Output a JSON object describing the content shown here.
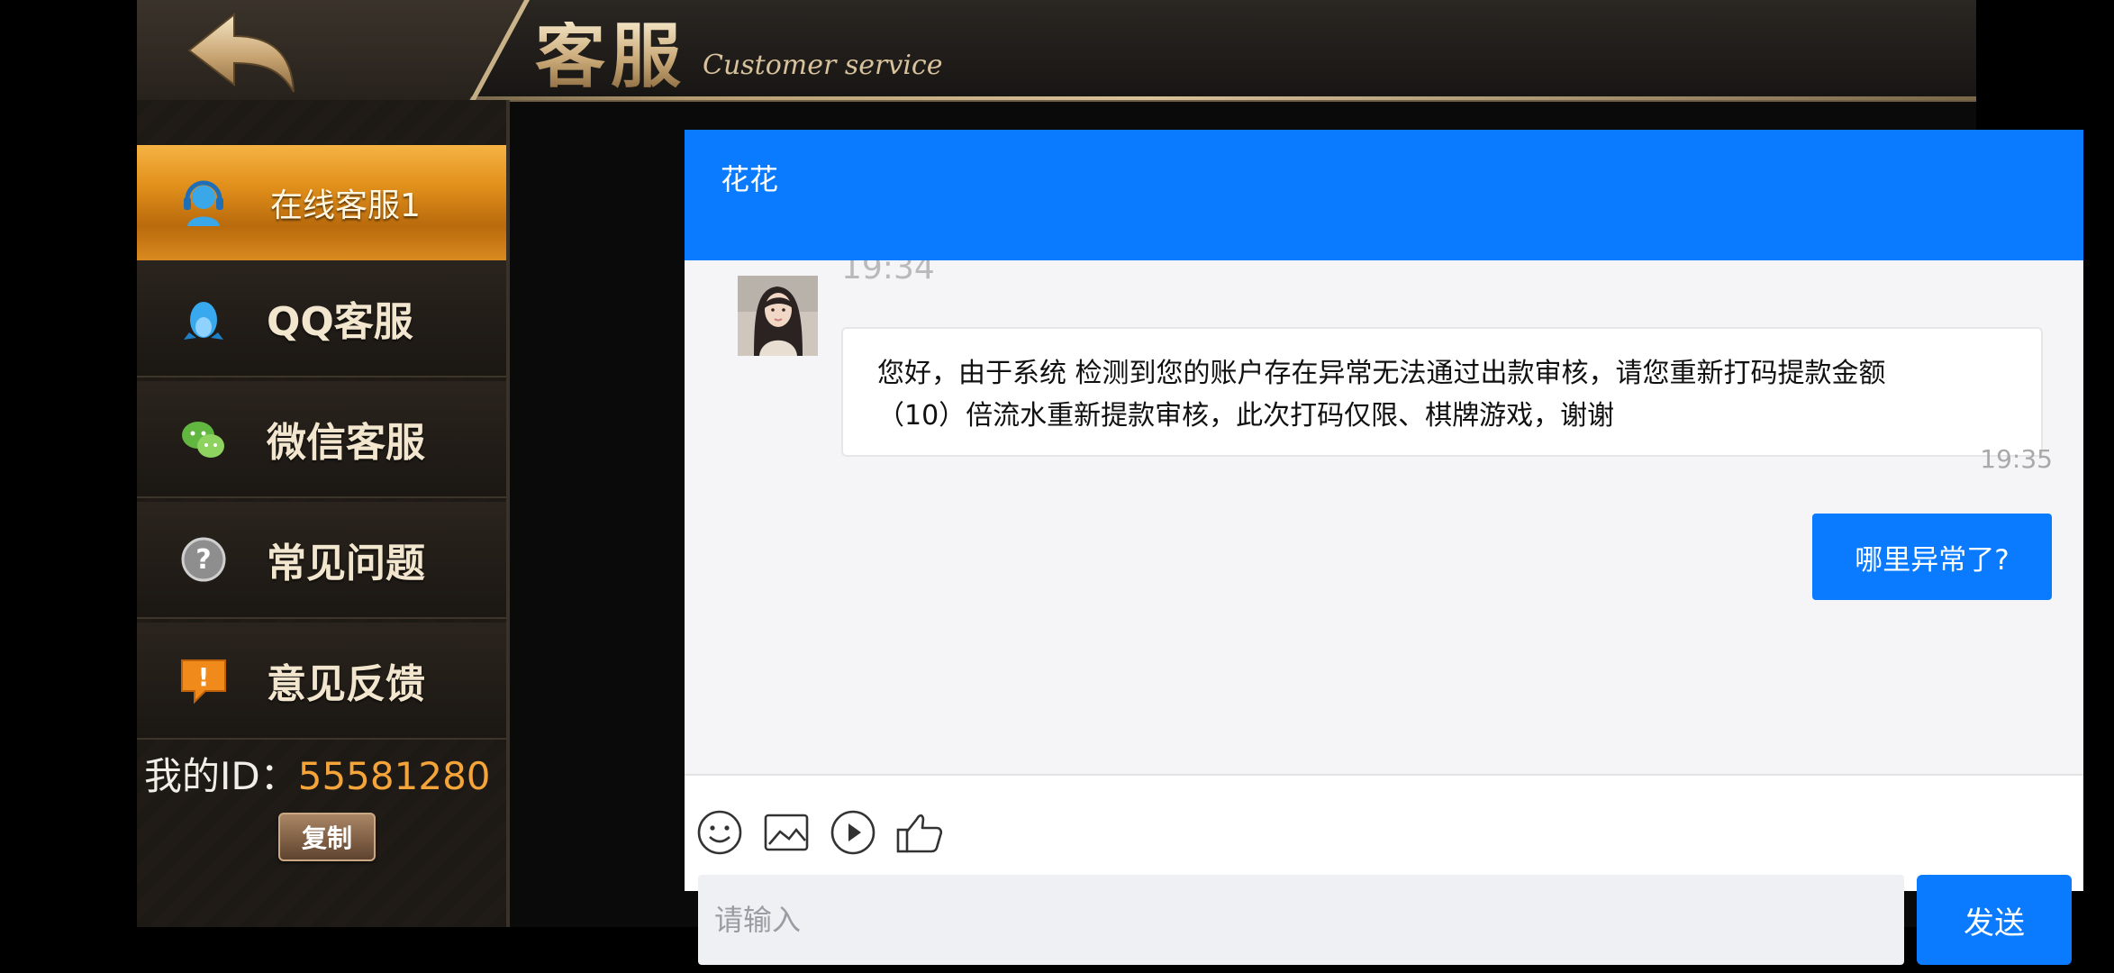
{
  "header": {
    "title_cn": "客服",
    "title_en": "Customer service"
  },
  "sidebar": {
    "items": [
      {
        "label": "在线客服1",
        "icon": "headset-icon",
        "active": true
      },
      {
        "label": "QQ客服",
        "icon": "qq-penguin-icon"
      },
      {
        "label": "微信客服",
        "icon": "wechat-icon"
      },
      {
        "label": "常见问题",
        "icon": "question-icon"
      },
      {
        "label": "意见反馈",
        "icon": "feedback-icon"
      }
    ],
    "id_label": "我的ID：",
    "id_value": "55581280",
    "copy_label": "复制"
  },
  "chat": {
    "agent_name": "花花",
    "messages": [
      {
        "from": "agent",
        "time": "19:34",
        "lines": [
          "您好，由于系统 检测到您的账户存在异常无法通过出款审核，请您重新打码提款金额",
          "（10）倍流水重新提款审核，此次打码仅限、棋牌游戏，谢谢"
        ]
      },
      {
        "from": "user",
        "time": "19:35",
        "text": "哪里异常了?"
      }
    ],
    "toolbar": [
      "smiley-icon",
      "image-icon",
      "video-icon",
      "thumbs-up-icon"
    ],
    "input_placeholder": "请输入",
    "send_label": "发送"
  },
  "colors": {
    "chat_blue": "#0a7bff",
    "sidebar_active": "#e2901b",
    "gold_text": "#c9a877",
    "id_orange": "#f5a43a"
  }
}
